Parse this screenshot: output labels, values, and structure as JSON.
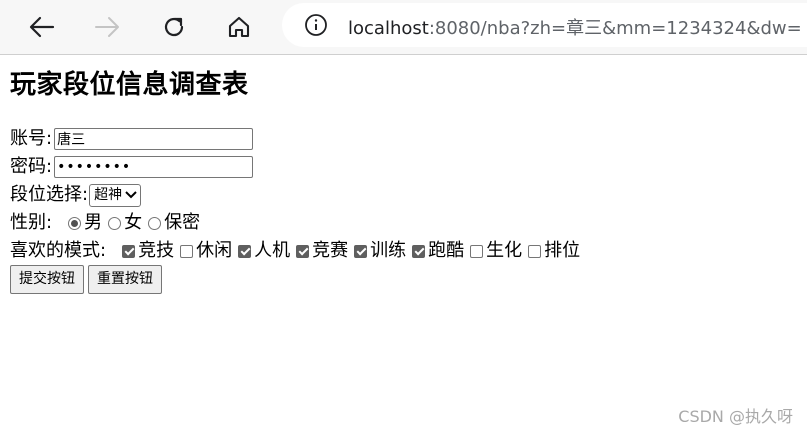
{
  "browser": {
    "url_host": "localhost",
    "url_rest": ":8080/nba?zh=章三&mm=1234324&dw="
  },
  "page": {
    "title": "玩家段位信息调查表"
  },
  "form": {
    "account_label": "账号:",
    "account_value": "唐三",
    "password_label": "密码:",
    "password_value": "••••••••",
    "rank_label": "段位选择:",
    "rank_selected": "超神",
    "gender_label": "性别:",
    "gender_options": [
      {
        "label": "男",
        "checked": true
      },
      {
        "label": "女",
        "checked": false
      },
      {
        "label": "保密",
        "checked": false
      }
    ],
    "modes_label": "喜欢的模式:",
    "mode_options": [
      {
        "label": "竞技",
        "checked": true
      },
      {
        "label": "休闲",
        "checked": false
      },
      {
        "label": "人机",
        "checked": true
      },
      {
        "label": "竞赛",
        "checked": true
      },
      {
        "label": "训练",
        "checked": true
      },
      {
        "label": "跑酷",
        "checked": true
      },
      {
        "label": "生化",
        "checked": false
      },
      {
        "label": "排位",
        "checked": false
      }
    ],
    "submit_label": "提交按钮",
    "reset_label": "重置按钮"
  },
  "watermark": "CSDN @执久呀"
}
